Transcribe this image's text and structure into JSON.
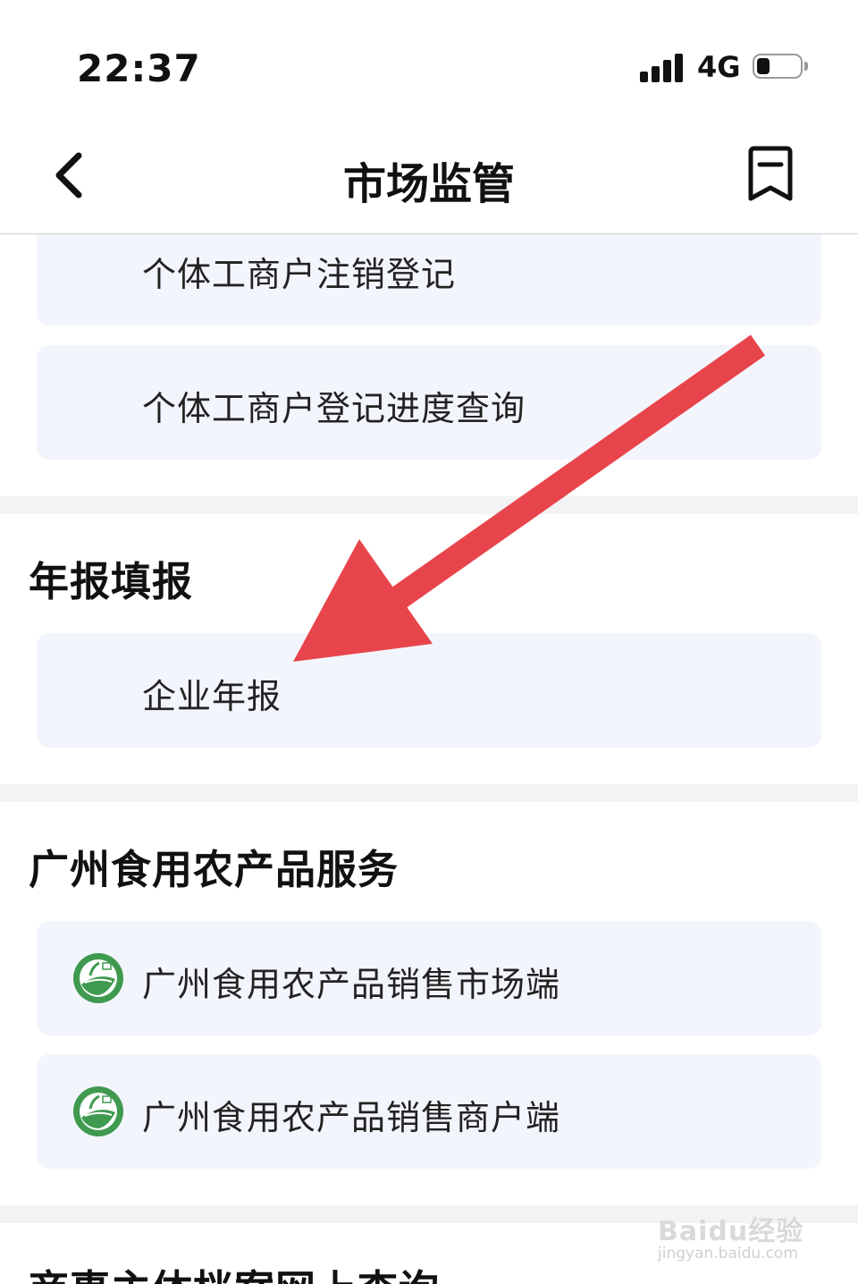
{
  "status_bar": {
    "time": "22:37",
    "network": "4G",
    "battery_level": 0.3
  },
  "nav": {
    "title": "市场监管",
    "back_icon": "chevron-left-icon",
    "bookmark_icon": "bookmark-icon"
  },
  "sections": {
    "top_items": [
      {
        "label": "个体工商户注销登记"
      },
      {
        "label": "个体工商户登记进度查询"
      }
    ],
    "annual_report": {
      "title": "年报填报",
      "items": [
        {
          "label": "企业年报"
        }
      ]
    },
    "guangzhou_food": {
      "title": "广州食用农产品服务",
      "items": [
        {
          "label": "广州食用农产品销售市场端",
          "icon": "farm-produce-logo-icon"
        },
        {
          "label": "广州食用农产品销售商户端",
          "icon": "farm-produce-logo-icon"
        }
      ]
    },
    "archive_query": {
      "title": "商事主体档案网上查询"
    }
  },
  "overlay": {
    "arrow_color": "#e8444b"
  },
  "watermark": {
    "text": "Baidu经验",
    "url": "jingyan.baidu.com"
  }
}
